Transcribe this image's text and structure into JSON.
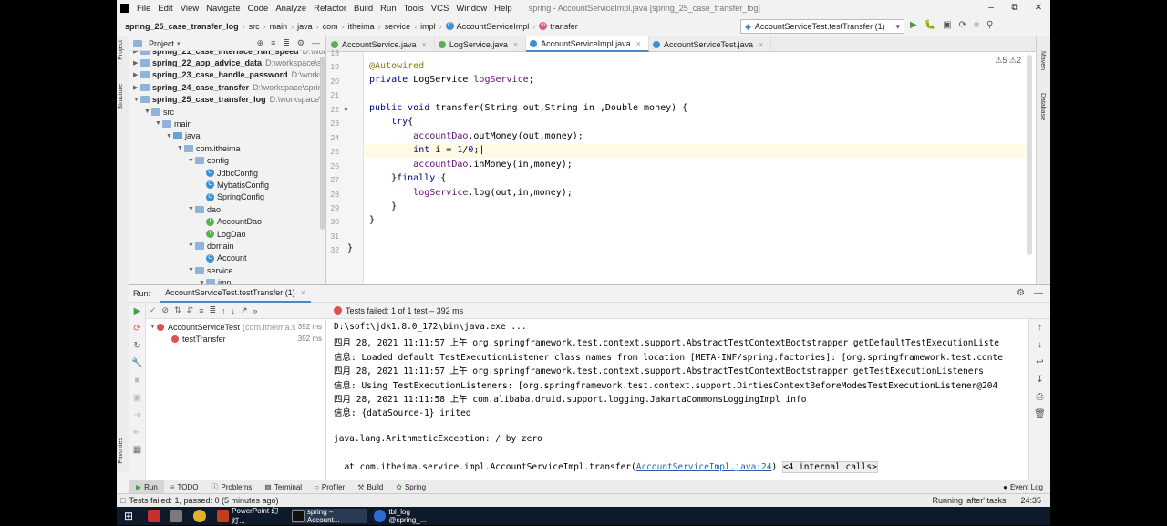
{
  "menu": {
    "items": [
      "File",
      "Edit",
      "View",
      "Navigate",
      "Code",
      "Analyze",
      "Refactor",
      "Build",
      "Run",
      "Tools",
      "VCS",
      "Window",
      "Help"
    ],
    "window_title": "spring - AccountServiceImpl.java [spring_25_case_transfer_log]"
  },
  "nav": {
    "project": "spring_25_case_transfer_log",
    "crumbs": [
      "src",
      "main",
      "java",
      "com",
      "itheima",
      "service",
      "impl",
      "AccountServiceImpl",
      "transfer"
    ],
    "run_config": "AccountServiceTest.testTransfer (1)"
  },
  "side": {
    "left_labels": [
      "Project",
      "Structure",
      "Favorites"
    ],
    "right_labels": [
      "Maven",
      "Database"
    ]
  },
  "project": {
    "label": "Project",
    "tree": [
      {
        "name": "spring_21_case_interface_run_speed",
        "path": "D:\\work",
        "level": 0,
        "type": "module"
      },
      {
        "name": "spring_22_aop_advice_data",
        "path": "D:\\workspace\\sp",
        "level": 0,
        "type": "module"
      },
      {
        "name": "spring_23_case_handle_password",
        "path": "D:\\worksp",
        "level": 0,
        "type": "module"
      },
      {
        "name": "spring_24_case_transfer",
        "path": "D:\\workspace\\spring",
        "level": 0,
        "type": "module"
      },
      {
        "name": "spring_25_case_transfer_log",
        "path": "D:\\workspace\\s",
        "level": 0,
        "type": "module"
      },
      {
        "name": "src",
        "path": "",
        "level": 1,
        "type": "folder"
      },
      {
        "name": "main",
        "path": "",
        "level": 2,
        "type": "folder"
      },
      {
        "name": "java",
        "path": "",
        "level": 3,
        "type": "src"
      },
      {
        "name": "com.itheima",
        "path": "",
        "level": 4,
        "type": "folder"
      },
      {
        "name": "config",
        "path": "",
        "level": 5,
        "type": "folder"
      },
      {
        "name": "JdbcConfig",
        "path": "",
        "level": 6,
        "type": "class"
      },
      {
        "name": "MybatisConfig",
        "path": "",
        "level": 6,
        "type": "class"
      },
      {
        "name": "SpringConfig",
        "path": "",
        "level": 6,
        "type": "class"
      },
      {
        "name": "dao",
        "path": "",
        "level": 5,
        "type": "folder"
      },
      {
        "name": "AccountDao",
        "path": "",
        "level": 6,
        "type": "interface"
      },
      {
        "name": "LogDao",
        "path": "",
        "level": 6,
        "type": "interface"
      },
      {
        "name": "domain",
        "path": "",
        "level": 5,
        "type": "folder"
      },
      {
        "name": "Account",
        "path": "",
        "level": 6,
        "type": "class"
      },
      {
        "name": "service",
        "path": "",
        "level": 5,
        "type": "folder"
      },
      {
        "name": "impl",
        "path": "",
        "level": 6,
        "type": "folder"
      }
    ]
  },
  "editor": {
    "tabs": [
      {
        "label": "AccountService.java",
        "color": "#5bae55"
      },
      {
        "label": "LogService.java",
        "color": "#5bae55"
      },
      {
        "label": "AccountServiceImpl.java",
        "color": "#3d8fd4"
      },
      {
        "label": "AccountServiceTest.java",
        "color": "#3d8fd4"
      }
    ],
    "warnings": "⚠5  ⚠2",
    "line_numbers": [
      "18",
      "19",
      "20",
      "21",
      "22",
      "23",
      "24",
      "25",
      "26",
      "27",
      "28",
      "29",
      "30",
      "31",
      "32"
    ]
  },
  "run": {
    "label": "Run:",
    "tab": "AccountServiceTest.testTransfer (1)",
    "status_prefix": "Tests failed:",
    "status_rest": "1 of 1 test – 392 ms",
    "tests": [
      {
        "name": "AccountServiceTest",
        "extra": "(com.itheima.s",
        "time": "392 ms"
      },
      {
        "name": "testTransfer",
        "extra": "",
        "time": "392 ms"
      }
    ],
    "console": [
      "D:\\soft\\jdk1.8.0_172\\bin\\java.exe ...",
      "四月 28, 2021 11:11:57 上午 org.springframework.test.context.support.AbstractTestContextBootstrapper getDefaultTestExecutionListe",
      "信息: Loaded default TestExecutionListener class names from location [META-INF/spring.factories]: [org.springframework.test.conte",
      "四月 28, 2021 11:11:57 上午 org.springframework.test.context.support.AbstractTestContextBootstrapper getTestExecutionListeners",
      "信息: Using TestExecutionListeners: [org.springframework.test.context.support.DirtiesContextBeforeModesTestExecutionListener@204",
      "四月 28, 2021 11:11:58 上午 com.alibaba.druid.support.logging.JakartaCommonsLoggingImpl info",
      "信息: {dataSource-1} inited",
      "",
      "java.lang.ArithmeticException: / by zero"
    ],
    "trace_prefix": "  at com.itheima.service.impl.AccountServiceImpl.transfer(",
    "trace_link": "AccountServiceImpl.java:24",
    "trace_close": ")",
    "trace_hint": "<4 internal calls>"
  },
  "bottom_tabs": [
    "Run",
    "TODO",
    "Problems",
    "Terminal",
    "Profiler",
    "Build",
    "Spring"
  ],
  "event_log": "Event Log",
  "status": {
    "left": "Tests failed: 1, passed: 0 (5 minutes ago)",
    "right": "Running 'after' tasks",
    "pos": "24:35"
  },
  "taskbar": [
    {
      "label": "PowerPoint 幻灯...",
      "color": "#c43e1c"
    },
    {
      "label": "spring – Account...",
      "color": "#333333"
    },
    {
      "label": "tbl_log @spring_...",
      "color": "#2a6bd4"
    }
  ]
}
